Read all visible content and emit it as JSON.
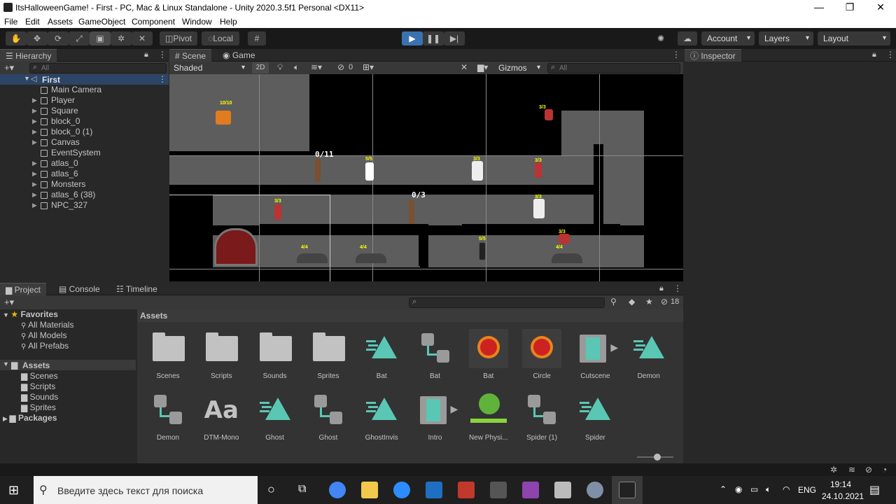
{
  "titlebar": {
    "title": "ItsHalloweenGame! - First - PC, Mac & Linux Standalone - Unity 2020.3.5f1 Personal <DX11>",
    "minimize": "—",
    "maximize": "❐",
    "close": "✕"
  },
  "menu": [
    "File",
    "Edit",
    "Assets",
    "GameObject",
    "Component",
    "Window",
    "Help"
  ],
  "toolbar": {
    "pivot_label": "Pivot",
    "local_label": "Local",
    "account_label": "Account",
    "layers_label": "Layers",
    "layout_label": "Layout"
  },
  "hierarchy": {
    "tab_label": "Hierarchy",
    "add_label": "+▾",
    "search_placeholder": "All",
    "scene_name": "First",
    "items": [
      {
        "label": "Main Camera",
        "arrow": ""
      },
      {
        "label": "Player",
        "arrow": "▶"
      },
      {
        "label": "Square",
        "arrow": "▶"
      },
      {
        "label": "block_0",
        "arrow": "▶"
      },
      {
        "label": "block_0 (1)",
        "arrow": "▶"
      },
      {
        "label": "Canvas",
        "arrow": "▶"
      },
      {
        "label": "EventSystem",
        "arrow": ""
      },
      {
        "label": "atlas_0",
        "arrow": "▶"
      },
      {
        "label": "atlas_6",
        "arrow": "▶"
      },
      {
        "label": "Monsters",
        "arrow": "▶"
      },
      {
        "label": "atlas_6 (38)",
        "arrow": "▶"
      },
      {
        "label": "NPC_327",
        "arrow": "▶"
      }
    ]
  },
  "scene": {
    "tabs": [
      "Scene",
      "Game"
    ],
    "shading_mode": "Shaded",
    "mode_2d": "2D",
    "hidden_count": "0",
    "gizmos_label": "Gizmos",
    "search_placeholder": "All",
    "counters": [
      "0/11",
      "0/3"
    ],
    "mob_labels": [
      "10/10",
      "3/3",
      "5/5",
      "3/3",
      "3/3",
      "3/3",
      "3/3",
      "3/3",
      "4/4",
      "4/4",
      "5/5",
      "4/4"
    ]
  },
  "inspector": {
    "tab_label": "Inspector"
  },
  "project": {
    "tabs": [
      "Project",
      "Console",
      "Timeline"
    ],
    "add_label": "+▾",
    "hidden_count": "18",
    "favorites_label": "Favorites",
    "favorites": [
      "All Materials",
      "All Models",
      "All Prefabs"
    ],
    "assets_root": "Assets",
    "asset_folders": [
      "Scenes",
      "Scripts",
      "Sounds",
      "Sprites"
    ],
    "packages_label": "Packages",
    "breadcrumb": "Assets",
    "assets_row1": [
      {
        "name": "Scenes",
        "icon": "folder-icon"
      },
      {
        "name": "Scripts",
        "icon": "folder-icon"
      },
      {
        "name": "Sounds",
        "icon": "folder-icon"
      },
      {
        "name": "Sprites",
        "icon": "folder-icon"
      },
      {
        "name": "Bat",
        "icon": "prefab-icon"
      },
      {
        "name": "Bat",
        "icon": "animator-icon"
      },
      {
        "name": "Bat",
        "icon": "sprite-icon"
      },
      {
        "name": "Circle",
        "icon": "sprite-icon"
      },
      {
        "name": "Cutscene",
        "icon": "timeline-icon"
      },
      {
        "name": "Demon",
        "icon": "prefab-icon"
      }
    ],
    "assets_row2": [
      {
        "name": "Demon",
        "icon": "animator-icon"
      },
      {
        "name": "DTM-Mono",
        "icon": "font-icon"
      },
      {
        "name": "Ghost",
        "icon": "prefab-icon"
      },
      {
        "name": "Ghost",
        "icon": "animator-icon"
      },
      {
        "name": "GhostInvis",
        "icon": "prefab-icon"
      },
      {
        "name": "Intro",
        "icon": "timeline-icon"
      },
      {
        "name": "New Physi...",
        "icon": "physics-material-icon"
      },
      {
        "name": "Spider (1)",
        "icon": "animator-icon"
      },
      {
        "name": "Spider",
        "icon": "prefab-icon"
      }
    ],
    "font_glyph": "Aa"
  },
  "taskbar": {
    "search_placeholder": "Введите здесь текст для поиска",
    "language": "ENG",
    "time": "19:14",
    "date": "24.10.2021"
  },
  "colors": {
    "accent": "#3a72b0",
    "prefab": "#5ac7b4",
    "scene_bg": "#000000"
  }
}
